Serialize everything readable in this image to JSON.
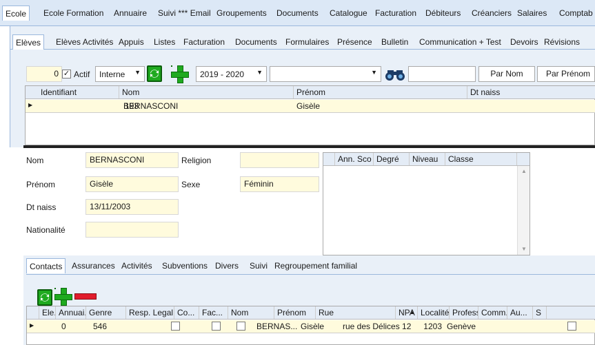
{
  "top_tabs": [
    "Ecole",
    "Ecole Formation",
    "Annuaire",
    "Suivi *** Email",
    "Groupements",
    "Documents",
    "Catalogue",
    "Facturation",
    "Débiteurs",
    "Créanciers",
    "Salaires",
    "Comptab"
  ],
  "sub_tabs": [
    "Elèves",
    "Elèves Activités",
    "Appuis",
    "Listes",
    "Facturation",
    "Documents",
    "Formulaires",
    "Présence",
    "Bulletin",
    "Communication + Test",
    "Devoirs",
    "Révisions"
  ],
  "filter": {
    "count": "0",
    "actif_label": "Actif",
    "type_value": "Interne",
    "year_value": "2019 - 2020",
    "search_value": "",
    "by_name_label": "Par Nom",
    "by_firstname_label": "Par Prénom"
  },
  "student_grid": {
    "columns": [
      "Identifiant",
      "Nom",
      "Prénom",
      "Dt naiss"
    ],
    "rows": [
      {
        "id": "193",
        "nom": "BERNASCONI",
        "prenom": "Gisèle",
        "dt_naiss": ""
      }
    ]
  },
  "detail": {
    "nom_label": "Nom",
    "nom_value": "BERNASCONI",
    "prenom_label": "Prénom",
    "prenom_value": "Gisèle",
    "dtnaiss_label": "Dt naiss",
    "dtnaiss_value": "13/11/2003",
    "nationalite_label": "Nationalité",
    "nationalite_value": "",
    "religion_label": "Religion",
    "religion_value": "",
    "sexe_label": "Sexe",
    "sexe_value": "Féminin"
  },
  "class_grid": {
    "columns": [
      "Ann. Sco",
      "Degré",
      "Niveau",
      "Classe"
    ]
  },
  "contact_tabs": [
    "Contacts",
    "Assurances",
    "Activités",
    "Subventions",
    "Divers",
    "Suivi",
    "Regroupement familial"
  ],
  "contact_grid": {
    "columns": [
      "Ele...",
      "Annuai...",
      "Genre",
      "Resp. Legal",
      "Co...",
      "Fac...",
      "Nom",
      "Prénom",
      "Rue",
      "NPA",
      "Localité",
      "Profess...",
      "Comm...",
      "Au...",
      "S"
    ],
    "row": {
      "ele": "0",
      "annuaire": "546",
      "genre": "",
      "nom": "BERNAS...",
      "prenom": "Gisèle",
      "rue": "rue des Délices 12",
      "npa": "1203",
      "localite": "Genève"
    }
  },
  "colors": {
    "accent": "#9ab7dc",
    "field": "#fffbdd",
    "header": "#dce8f6",
    "panel": "#e9f0f8"
  }
}
